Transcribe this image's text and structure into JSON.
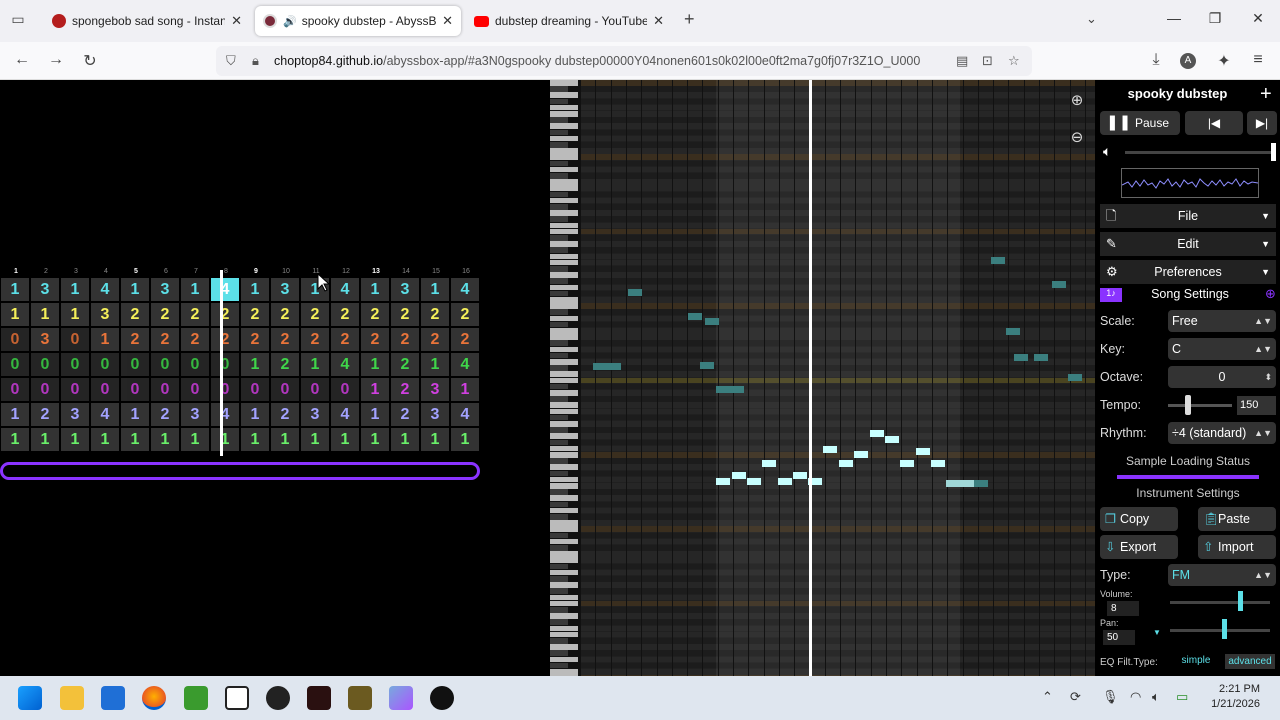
{
  "browser": {
    "tabs": [
      {
        "title": "spongebob sad song - Instant S",
        "active": false,
        "color": "#b41d1d"
      },
      {
        "title": "spooky dubstep - AbyssBox",
        "active": true,
        "color": "#7a2a3a"
      },
      {
        "title": "dubstep dreaming - YouTube",
        "active": false,
        "color": "#ff0000"
      }
    ],
    "url_host": "choptop84.github.io",
    "url_path": "/abyssbox-app/#a3N0gspooky dubstep00000Y04nonen601s0k02l00e0ft2ma7g0fj07r3Z1O_U000"
  },
  "pattern": {
    "bar_numbers": [
      "1",
      "2",
      "3",
      "4",
      "5",
      "6",
      "7",
      "8",
      "9",
      "10",
      "11",
      "12",
      "13",
      "14",
      "15",
      "16"
    ],
    "rows": [
      {
        "color": "#5ce0e8",
        "values": [
          "1",
          "3",
          "1",
          "4",
          "1",
          "3",
          "1",
          "4",
          "1",
          "3",
          "1",
          "4",
          "1",
          "3",
          "1",
          "4"
        ]
      },
      {
        "color": "#f5f05a",
        "values": [
          "1",
          "1",
          "1",
          "3",
          "2",
          "2",
          "2",
          "2",
          "2",
          "2",
          "2",
          "2",
          "2",
          "2",
          "2",
          "2"
        ]
      },
      {
        "color": "#e8743a",
        "values": [
          "0",
          "3",
          "0",
          "1",
          "2",
          "2",
          "2",
          "2",
          "2",
          "2",
          "2",
          "2",
          "2",
          "2",
          "2",
          "2"
        ]
      },
      {
        "color": "#3fd64a",
        "values": [
          "0",
          "0",
          "0",
          "0",
          "0",
          "0",
          "0",
          "0",
          "1",
          "2",
          "1",
          "4",
          "1",
          "2",
          "1",
          "4"
        ]
      },
      {
        "color": "#d040e0",
        "values": [
          "0",
          "0",
          "0",
          "0",
          "0",
          "0",
          "0",
          "0",
          "0",
          "0",
          "0",
          "0",
          "1",
          "2",
          "3",
          "1"
        ]
      },
      {
        "color": "#a3a3ff",
        "values": [
          "1",
          "2",
          "3",
          "4",
          "1",
          "2",
          "3",
          "4",
          "1",
          "2",
          "3",
          "4",
          "1",
          "2",
          "3",
          "4"
        ]
      },
      {
        "color": "#6af06a",
        "values": [
          "1",
          "1",
          "1",
          "1",
          "1",
          "1",
          "1",
          "1",
          "1",
          "1",
          "1",
          "1",
          "1",
          "1",
          "1",
          "1"
        ]
      }
    ]
  },
  "sidebar": {
    "song_title": "spooky dubstep",
    "pause_label": "Pause",
    "menus": [
      "File",
      "Edit",
      "Preferences"
    ],
    "song_settings_label": "Song Settings",
    "scale_label": "Scale:",
    "scale_value": "Free",
    "key_label": "Key:",
    "key_value": "C",
    "octave_label": "Octave:",
    "octave_value": "0",
    "tempo_label": "Tempo:",
    "tempo_value": "150",
    "rhythm_label": "Rhythm:",
    "rhythm_value": "÷4 (standard)",
    "sample_status": "Sample Loading Status",
    "instrument_settings": "Instrument Settings",
    "copy": "Copy",
    "paste": "Paste",
    "export": "Export",
    "import": "Import",
    "type_label": "Type:",
    "type_value": "FM",
    "volume_label": "Volume:",
    "volume_value": "8",
    "pan_label": "Pan:",
    "pan_value": "50",
    "eq_label": "EQ Filt.Type:",
    "eq_simple": "simple",
    "eq_advanced": "advanced"
  },
  "taskbar": {
    "time": "2:21 PM",
    "date": "1/21/2026"
  }
}
